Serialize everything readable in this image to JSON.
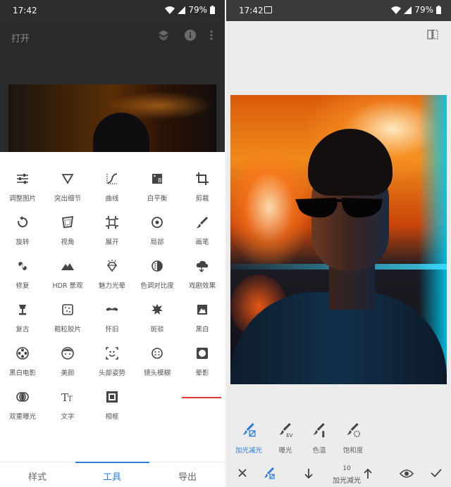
{
  "status_bar": {
    "time": "17:42",
    "battery": "79%"
  },
  "left": {
    "header": {
      "open_label": "打开"
    },
    "tools": [
      {
        "label": "调整图片",
        "icon": "tune-sliders-icon"
      },
      {
        "label": "突出细节",
        "icon": "details-triangle-icon"
      },
      {
        "label": "曲线",
        "icon": "curves-icon"
      },
      {
        "label": "白平衡",
        "icon": "white-balance-icon"
      },
      {
        "label": "剪裁",
        "icon": "crop-icon"
      },
      {
        "label": "旋转",
        "icon": "rotate-icon"
      },
      {
        "label": "视角",
        "icon": "perspective-icon"
      },
      {
        "label": "展开",
        "icon": "expand-icon"
      },
      {
        "label": "局部",
        "icon": "selective-target-icon"
      },
      {
        "label": "画笔",
        "icon": "brush-icon"
      },
      {
        "label": "修复",
        "icon": "healing-bandage-icon"
      },
      {
        "label": "HDR 景观",
        "icon": "mountain-hdr-icon"
      },
      {
        "label": "魅力光晕",
        "icon": "glamour-glow-icon"
      },
      {
        "label": "色调对比度",
        "icon": "tonal-contrast-icon"
      },
      {
        "label": "戏剧效果",
        "icon": "drama-cloud-icon"
      },
      {
        "label": "复古",
        "icon": "vintage-lamp-icon"
      },
      {
        "label": "粗粒胶片",
        "icon": "grainy-film-icon"
      },
      {
        "label": "怀旧",
        "icon": "mustache-icon"
      },
      {
        "label": "斑驳",
        "icon": "grunge-icon"
      },
      {
        "label": "黑白",
        "icon": "black-white-icon"
      },
      {
        "label": "黑白电影",
        "icon": "film-reel-icon"
      },
      {
        "label": "美颜",
        "icon": "face-icon"
      },
      {
        "label": "头部姿势",
        "icon": "head-pose-icon"
      },
      {
        "label": "镜头模糊",
        "icon": "lens-blur-icon"
      },
      {
        "label": "晕影",
        "icon": "vignette-icon"
      },
      {
        "label": "双重曝光",
        "icon": "double-exposure-icon"
      },
      {
        "label": "文字",
        "icon": "text-tt-icon"
      },
      {
        "label": "相框",
        "icon": "frame-icon"
      }
    ],
    "active_tool": "画笔",
    "nav": {
      "styles": "样式",
      "tools": "工具",
      "export": "导出"
    }
  },
  "right": {
    "brush_tools": [
      {
        "label": "加光减光",
        "icon": "dodge-burn-brush-icon",
        "active": true
      },
      {
        "label": "曝光",
        "icon": "exposure-brush-icon",
        "active": false
      },
      {
        "label": "色温",
        "icon": "temperature-brush-icon",
        "active": false
      },
      {
        "label": "饱和度",
        "icon": "saturation-brush-icon",
        "active": false
      }
    ],
    "bottom": {
      "value": "10",
      "mode": "加光减光"
    }
  },
  "colors": {
    "accent": "#2e7ddb",
    "underline": "#e53935",
    "icon": "#444444"
  }
}
